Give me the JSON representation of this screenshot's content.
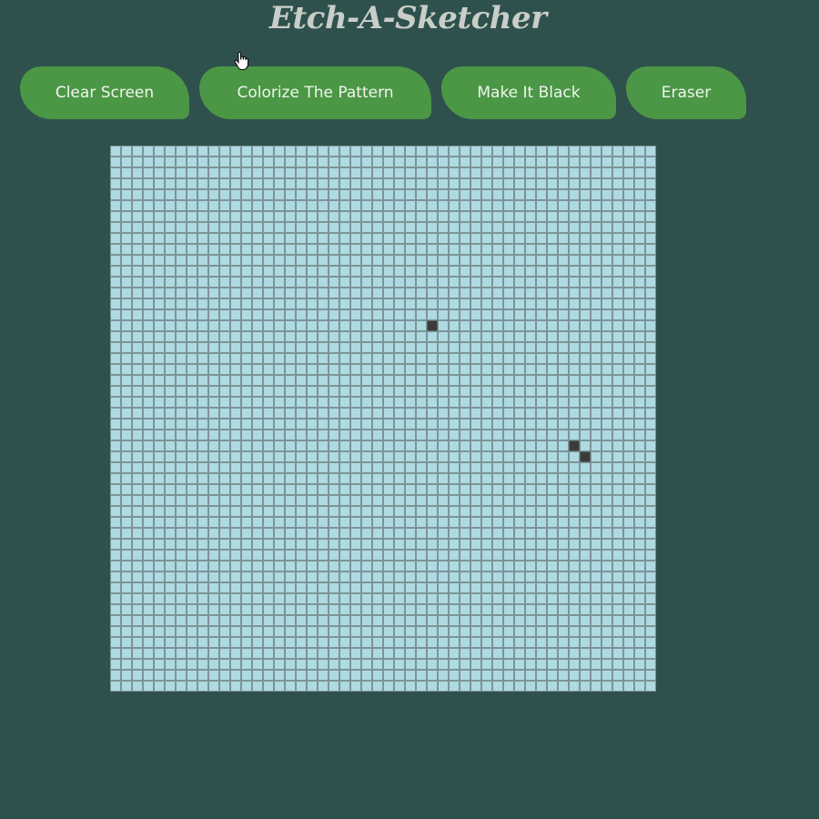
{
  "app": {
    "title": "Etch-A-Sketcher"
  },
  "toolbar": {
    "clear_label": "Clear Screen",
    "colorize_label": "Colorize The Pattern",
    "black_label": "Make It Black",
    "eraser_label": "Eraser"
  },
  "grid": {
    "rows": 50,
    "columns": 50,
    "filled_cells": [
      {
        "row": 16,
        "col": 29
      },
      {
        "row": 27,
        "col": 42
      },
      {
        "row": 28,
        "col": 43
      }
    ]
  },
  "colors": {
    "background": "#2f514d",
    "button": "#4b9745",
    "cell": "#aedae2",
    "filled_cell": "#3b3b3b"
  },
  "icons": {
    "cursor": "hand-pointer-icon"
  }
}
